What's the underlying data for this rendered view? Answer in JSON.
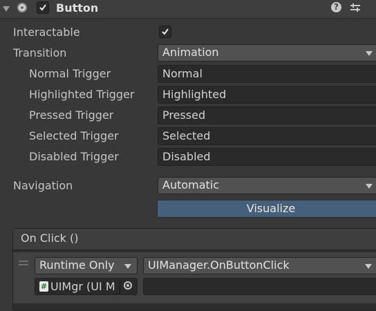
{
  "header": {
    "title": "Button",
    "enabled": true
  },
  "properties": {
    "interactable": {
      "label": "Interactable",
      "checked": true
    },
    "transition": {
      "label": "Transition",
      "value": "Animation"
    },
    "triggers": [
      {
        "label": "Normal Trigger",
        "value": "Normal"
      },
      {
        "label": "Highlighted Trigger",
        "value": "Highlighted"
      },
      {
        "label": "Pressed Trigger",
        "value": "Pressed"
      },
      {
        "label": "Selected Trigger",
        "value": "Selected"
      },
      {
        "label": "Disabled Trigger",
        "value": "Disabled"
      }
    ],
    "navigation": {
      "label": "Navigation",
      "value": "Automatic"
    },
    "visualize_label": "Visualize"
  },
  "on_click": {
    "title": "On Click ()",
    "runtime": "Runtime Only",
    "function": "UIManager.OnButtonClick",
    "object": "UIMgr (UI M",
    "object_icon": "#"
  },
  "colors": {
    "background": "#383838",
    "field": "#2a2a2a",
    "dropdown": "#515151",
    "visualize": "#46607c"
  }
}
